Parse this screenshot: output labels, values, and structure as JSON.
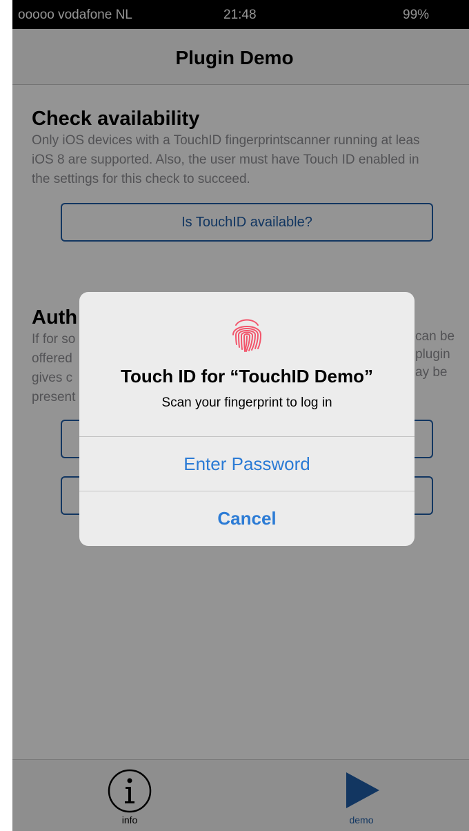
{
  "status_bar": {
    "carrier": "ooooo vodafone NL",
    "time": "21:48",
    "battery": "99%"
  },
  "nav": {
    "title": "Plugin Demo"
  },
  "check_section": {
    "title": "Check availability",
    "description_lines": [
      "Only iOS devices with a TouchID fingerprintscanner running at leas",
      "iOS 8 are supported. Also, the user must have Touch ID enabled in",
      "the settings for this check to succeed."
    ],
    "button_label": "Is TouchID available?"
  },
  "auth_section": {
    "title": "Auth",
    "description_left": [
      "If for so",
      "offered",
      "gives c",
      "present"
    ],
    "description_right": [
      "can be",
      "plugin",
      "ay be"
    ]
  },
  "alert": {
    "icon": "fingerprint-icon",
    "title": "Touch ID for “TouchID Demo”",
    "message": "Scan your fingerprint to log in",
    "primary_button": "Enter Password",
    "cancel_button": "Cancel"
  },
  "tabs": [
    {
      "label": "info",
      "icon": "info-circle-icon",
      "active": false
    },
    {
      "label": "demo",
      "icon": "play-icon",
      "active": true
    }
  ],
  "colors": {
    "accent": "#1f5ea8",
    "alert_button": "#2b7bd5",
    "fingerprint": "#f2556b"
  }
}
